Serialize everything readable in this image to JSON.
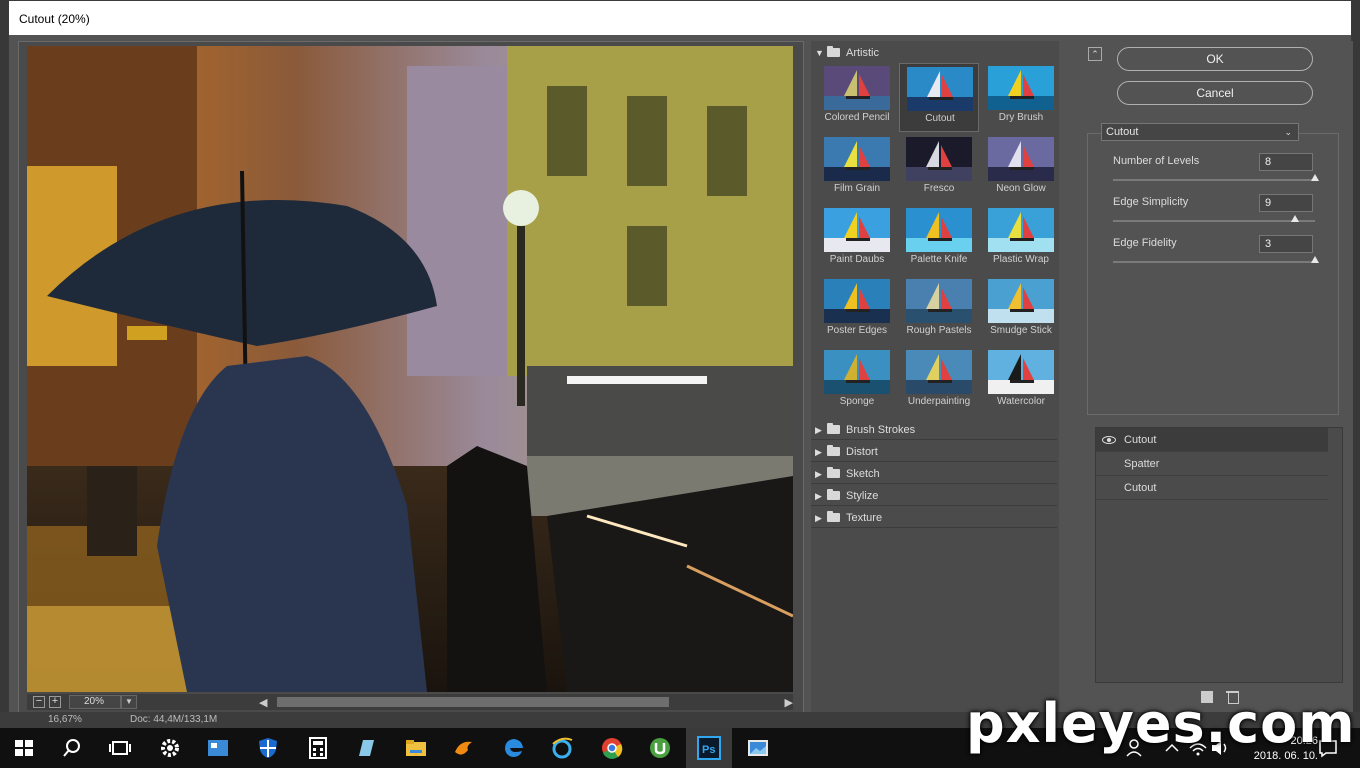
{
  "window": {
    "title": "Cutout (20%)"
  },
  "status_strip": {
    "zoom": "16,67%",
    "doc": "Doc: 44,4M/133,1M"
  },
  "preview": {
    "zoom_value": "20%",
    "minus_label": "−",
    "plus_label": "+"
  },
  "gallery": {
    "open_category": "Artistic",
    "filters": [
      {
        "label": "Colored Pencil"
      },
      {
        "label": "Cutout"
      },
      {
        "label": "Dry Brush"
      },
      {
        "label": "Film Grain"
      },
      {
        "label": "Fresco"
      },
      {
        "label": "Neon Glow"
      },
      {
        "label": "Paint Daubs"
      },
      {
        "label": "Palette Knife"
      },
      {
        "label": "Plastic Wrap"
      },
      {
        "label": "Poster Edges"
      },
      {
        "label": "Rough Pastels"
      },
      {
        "label": "Smudge Stick"
      },
      {
        "label": "Sponge"
      },
      {
        "label": "Underpainting"
      },
      {
        "label": "Watercolor"
      }
    ],
    "selected_filter": "Cutout",
    "other_categories": [
      "Brush Strokes",
      "Distort",
      "Sketch",
      "Stylize",
      "Texture"
    ]
  },
  "actions": {
    "ok_label": "OK",
    "cancel_label": "Cancel"
  },
  "settings": {
    "filter_select": "Cutout",
    "params": [
      {
        "label": "Number of Levels",
        "value": "8",
        "fraction": 1.0
      },
      {
        "label": "Edge Simplicity",
        "value": "9",
        "fraction": 0.9
      },
      {
        "label": "Edge Fidelity",
        "value": "3",
        "fraction": 1.0
      }
    ]
  },
  "layers": [
    "Cutout",
    "Spatter",
    "Cutout"
  ],
  "taskbar": {
    "time": "20:26",
    "date": "2018. 06. 10."
  },
  "watermark": "pxleyes.com"
}
